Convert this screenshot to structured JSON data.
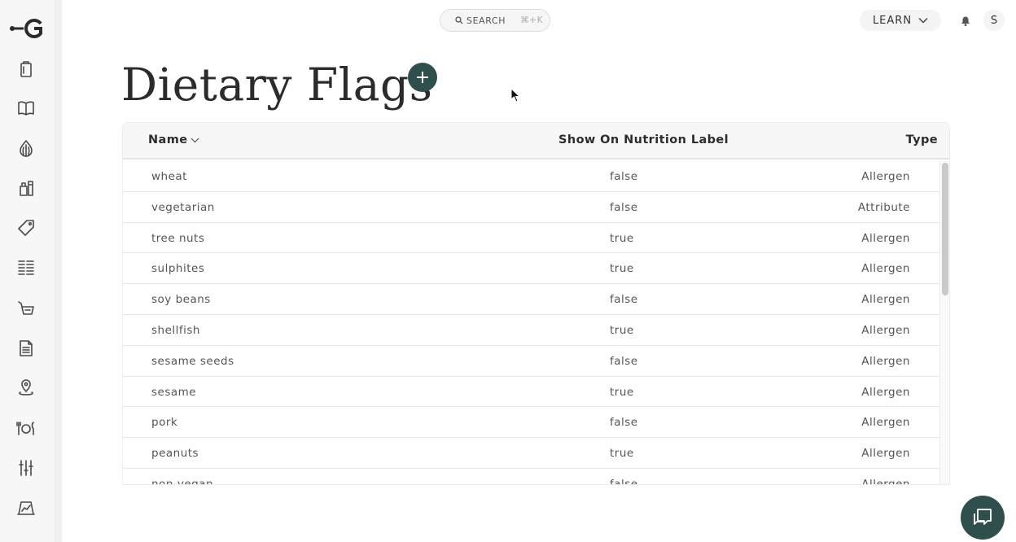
{
  "app": {
    "logo_icon": "logo-key-g-icon",
    "accent_color": "#2f4f4c"
  },
  "sidebar": {
    "items": [
      {
        "name": "clipboard"
      },
      {
        "name": "book"
      },
      {
        "name": "onion"
      },
      {
        "name": "bottle"
      },
      {
        "name": "tag"
      },
      {
        "name": "menu-grid"
      },
      {
        "name": "cart"
      },
      {
        "name": "document"
      },
      {
        "name": "location"
      },
      {
        "name": "plate"
      },
      {
        "name": "sliders"
      },
      {
        "name": "chart-board"
      }
    ]
  },
  "topbar": {
    "search_label": "SEARCH",
    "search_shortcut": "⌘+K",
    "learn_label": "LEARN",
    "avatar_initial": "S"
  },
  "page": {
    "title": "Dietary Flags"
  },
  "table": {
    "columns": {
      "name": "Name",
      "show": "Show On Nutrition Label",
      "type": "Type"
    },
    "rows": [
      {
        "name": "wheat",
        "show": "false",
        "type": "Allergen"
      },
      {
        "name": "vegetarian",
        "show": "false",
        "type": "Attribute"
      },
      {
        "name": "tree nuts",
        "show": "true",
        "type": "Allergen"
      },
      {
        "name": "sulphites",
        "show": "true",
        "type": "Allergen"
      },
      {
        "name": "soy beans",
        "show": "false",
        "type": "Allergen"
      },
      {
        "name": "shellfish",
        "show": "true",
        "type": "Allergen"
      },
      {
        "name": "sesame seeds",
        "show": "false",
        "type": "Allergen"
      },
      {
        "name": "sesame",
        "show": "true",
        "type": "Allergen"
      },
      {
        "name": "pork",
        "show": "false",
        "type": "Allergen"
      },
      {
        "name": "peanuts",
        "show": "true",
        "type": "Allergen"
      },
      {
        "name": "non-vegan",
        "show": "false",
        "type": "Allergen"
      }
    ]
  }
}
